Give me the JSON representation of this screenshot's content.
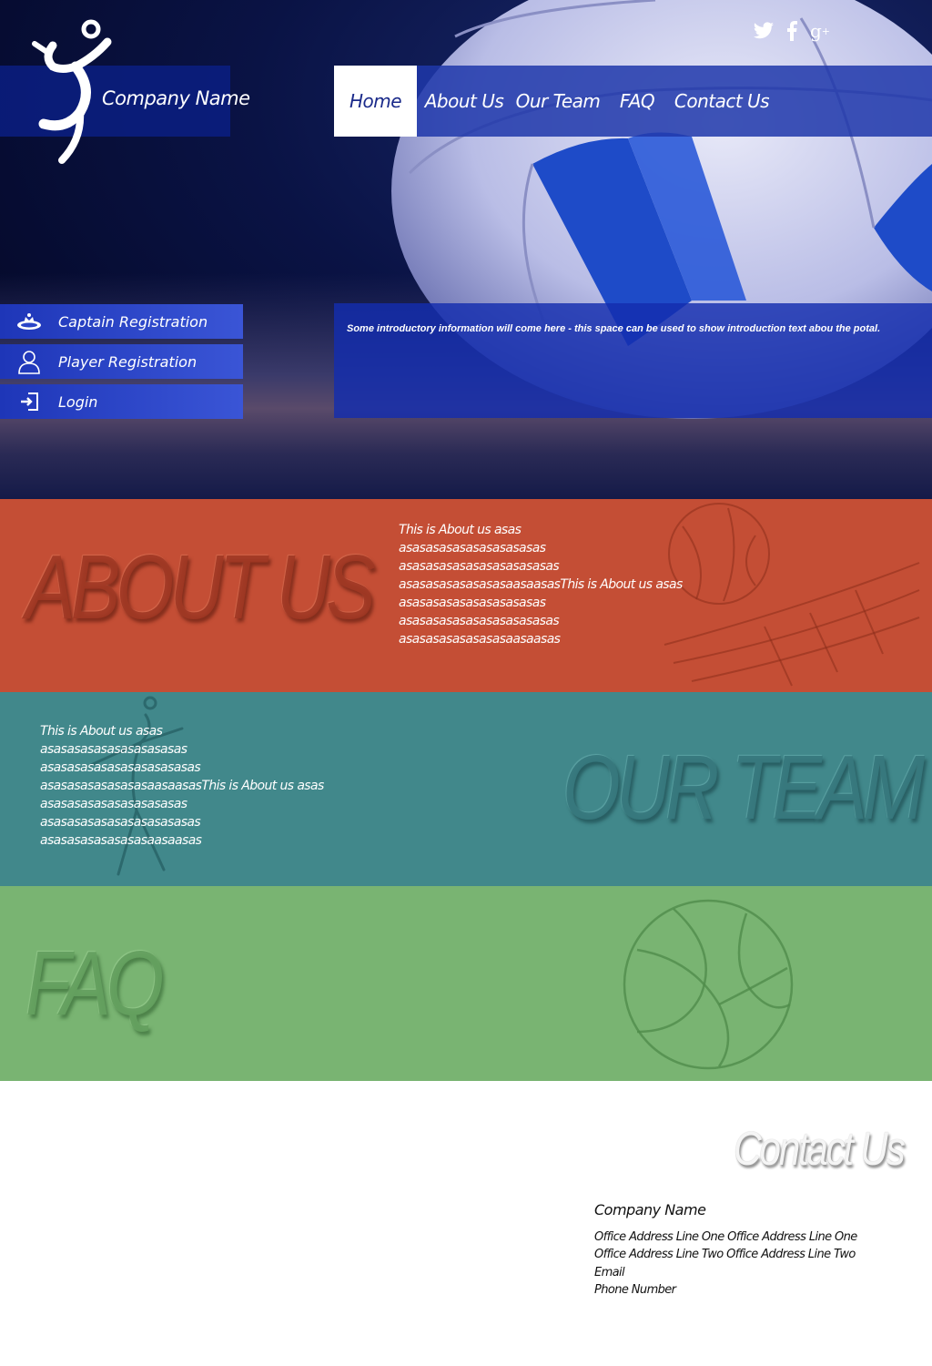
{
  "brand": {
    "company_name": "Company Name"
  },
  "nav": {
    "items": [
      {
        "label": "Home",
        "active": true
      },
      {
        "label": "About Us"
      },
      {
        "label": "Our Team"
      },
      {
        "label": "FAQ"
      },
      {
        "label": "Contact Us"
      }
    ]
  },
  "social": {
    "icons": [
      "twitter-icon",
      "facebook-icon",
      "google-plus-icon"
    ]
  },
  "sidebar": {
    "items": [
      {
        "label": "Captain Registration",
        "icon": "captain-icon"
      },
      {
        "label": "Player Registration",
        "icon": "user-icon"
      },
      {
        "label": "Login",
        "icon": "login-icon"
      }
    ]
  },
  "intro": {
    "text": "Some introductory information will come here - this space can be used to show introduction text abou the potal."
  },
  "about": {
    "title": "ABOUT US",
    "lines": [
      "This is About us asas",
      "asasasasasasasasasasas",
      "asasasasasasasasasasasas",
      "asasasasasasasasaasaasasThis is About us asas",
      "asasasasasasasasasasas",
      "asasasasasasasasasasasas",
      "asasasasasasasasaasaasas"
    ]
  },
  "team": {
    "title": "OUR TEAM",
    "lines": [
      "This is About us asas",
      "asasasasasasasasasasas",
      "asasasasasasasasasasasas",
      "asasasasasasasasaasaasasThis is About us asas",
      "asasasasasasasasasasas",
      "asasasasasasasasasasasas",
      "asasasasasasasasaasaasas"
    ]
  },
  "faq": {
    "title": "FAQ"
  },
  "contact": {
    "title": "Contact Us",
    "company": "Company Name",
    "address1": "Office Address Line One Office Address Line One",
    "address2": "Office Address Line Two Office Address Line Two",
    "email": "Email",
    "phone": "Phone Number"
  },
  "colors": {
    "about_bg": "#c44e35",
    "team_bg": "#41888b",
    "faq_bg": "#79b472",
    "nav_bg": "#1e37aa",
    "accent_blue": "#1a2a8a"
  }
}
